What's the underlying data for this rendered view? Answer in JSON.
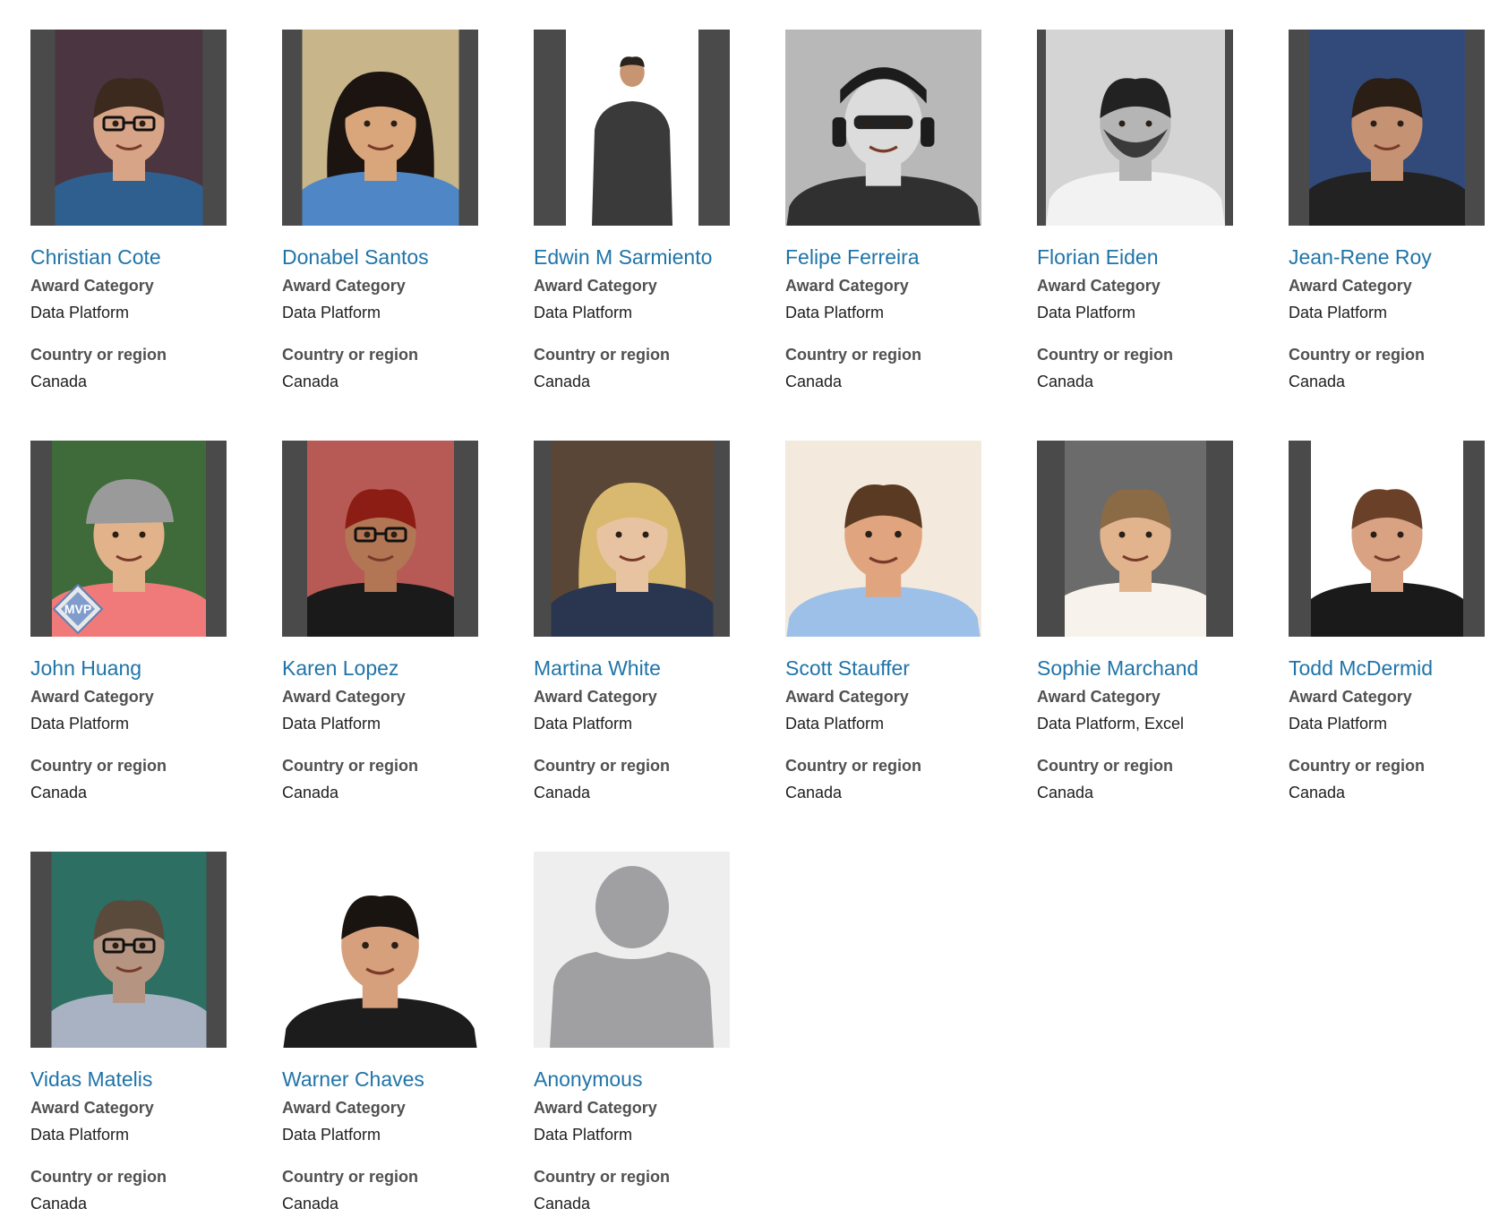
{
  "labels": {
    "award_category": "Award Category",
    "country_or_region": "Country or region"
  },
  "colors": {
    "name_link": "#1f74a8",
    "label": "#505050",
    "value": "#1e1e1e",
    "photo_frame": "#4a4a4a",
    "placeholder_bg": "#eeeeee",
    "placeholder_figure": "#a0a0a2"
  },
  "profiles": [
    {
      "name": "Christian Cote",
      "award": "Data Platform",
      "country": "Canada",
      "photo": "framed-portrait"
    },
    {
      "name": "Donabel Santos",
      "award": "Data Platform",
      "country": "Canada",
      "photo": "framed-portrait"
    },
    {
      "name": "Edwin M Sarmiento",
      "award": "Data Platform",
      "country": "Canada",
      "photo": "framed-portrait"
    },
    {
      "name": "Felipe Ferreira",
      "award": "Data Platform",
      "country": "Canada",
      "photo": "full-portrait"
    },
    {
      "name": "Florian Eiden",
      "award": "Data Platform",
      "country": "Canada",
      "photo": "framed-portrait"
    },
    {
      "name": "Jean-Rene Roy",
      "award": "Data Platform",
      "country": "Canada",
      "photo": "framed-portrait"
    },
    {
      "name": "John Huang",
      "award": "Data Platform",
      "country": "Canada",
      "photo": "framed-portrait",
      "badge": "MVP"
    },
    {
      "name": "Karen Lopez",
      "award": "Data Platform",
      "country": "Canada",
      "photo": "framed-portrait"
    },
    {
      "name": "Martina White",
      "award": "Data Platform",
      "country": "Canada",
      "photo": "framed-portrait"
    },
    {
      "name": "Scott Stauffer",
      "award": "Data Platform",
      "country": "Canada",
      "photo": "full-portrait"
    },
    {
      "name": "Sophie Marchand",
      "award": "Data Platform, Excel",
      "country": "Canada",
      "photo": "framed-portrait"
    },
    {
      "name": "Todd McDermid",
      "award": "Data Platform",
      "country": "Canada",
      "photo": "framed-portrait"
    },
    {
      "name": "Vidas Matelis",
      "award": "Data Platform",
      "country": "Canada",
      "photo": "framed-portrait"
    },
    {
      "name": "Warner Chaves",
      "award": "Data Platform",
      "country": "Canada",
      "photo": "full-portrait"
    },
    {
      "name": "Anonymous",
      "award": "Data Platform",
      "country": "Canada",
      "photo": "placeholder-avatar"
    }
  ]
}
